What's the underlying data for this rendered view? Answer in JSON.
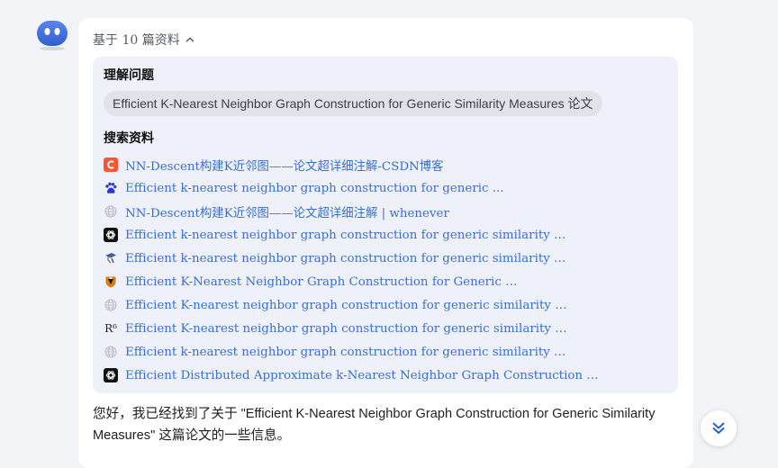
{
  "sources": {
    "toggle_label": "基于 10 篇资料"
  },
  "understand": {
    "title": "理解问题",
    "query": "Efficient K-Nearest Neighbor Graph Construction for Generic Similarity Measures 论文"
  },
  "search": {
    "title": "搜索资料",
    "results": [
      {
        "title": "NN-Descent构建K近邻图——论文超详细注解-CSDN博客",
        "icon": "csdn-icon"
      },
      {
        "title": "Efficient k-nearest neighbor graph construction for generic ...",
        "icon": "baidu-paw-icon"
      },
      {
        "title": "NN-Descent构建K近邻图——论文超详细注解 | whenever",
        "icon": "globe-icon"
      },
      {
        "title": "Efficient k-nearest neighbor graph construction for generic similarity …",
        "icon": "openai-icon"
      },
      {
        "title": "Efficient k-nearest neighbor graph construction for generic similarity …",
        "icon": "scholar-icon"
      },
      {
        "title": "Efficient K-Nearest Neighbor Graph Construction for Generic …",
        "icon": "university-shield-icon"
      },
      {
        "title": "Efficient K-nearest neighbor graph construction for generic similarity …",
        "icon": "globe-icon"
      },
      {
        "title": "Efficient K-nearest neighbor graph construction for generic similarity …",
        "icon": "researchgate-icon"
      },
      {
        "title": "Efficient k-nearest neighbor graph construction for generic similarity …",
        "icon": "globe-icon"
      },
      {
        "title": "Efficient Distributed Approximate k-Nearest Neighbor Graph Construction …",
        "icon": "openai-icon"
      }
    ]
  },
  "answer": {
    "text": "您好，我已经找到了关于 \"Efficient K-Nearest Neighbor Graph Construction for Generic Similarity Measures\" 这篇论文的一些信息。"
  },
  "icons": {
    "avatar": "bot-avatar-icon",
    "toggle": "chevron-up-icon",
    "scroll": "double-chevron-down-icon"
  },
  "colors": {
    "accent": "#2f5fcf",
    "link": "#3a6fcf",
    "csdn": "#fc5531"
  },
  "researchgate_mark": "R⁶"
}
